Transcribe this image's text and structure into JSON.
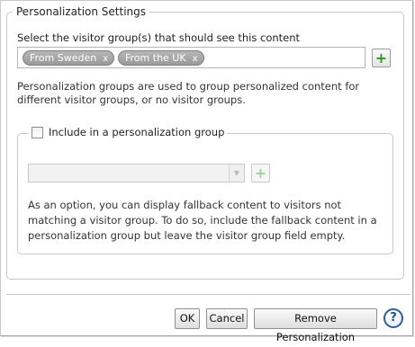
{
  "dialog": {
    "section_title": "Personalization Settings",
    "select_label": "Select the visitor group(s) that should see this content",
    "selected_groups": [
      {
        "label": "From Sweden",
        "remove": "x"
      },
      {
        "label": "From the UK",
        "remove": "x"
      }
    ],
    "add_icon": "plus-icon",
    "description": "Personalization groups are used to group personalized content for different visitor groups, or no visitor groups.",
    "group_section": {
      "checkbox_label": "Include in a personalization group",
      "checked": false,
      "dropdown_value": "",
      "fallback_text": "As an option, you can display fallback content to visitors not matching a visitor group. To do so, include the fallback content in a personalization group but leave the visitor group field empty."
    }
  },
  "buttons": {
    "ok": "OK",
    "cancel": "Cancel",
    "remove": "Remove Personalization",
    "help": "?"
  },
  "colors": {
    "tag_background": "#a8a8a8",
    "add_icon": "#2f9a22",
    "help_icon": "#2f5d9e"
  }
}
